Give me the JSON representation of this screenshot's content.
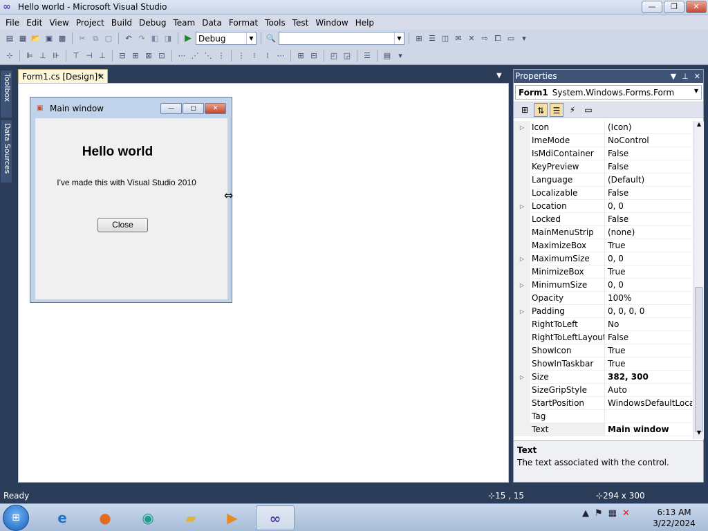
{
  "window": {
    "title": "Hello world - Microsoft Visual Studio",
    "buttons": {
      "minimize": "—",
      "restore": "❐",
      "close": "✕"
    }
  },
  "menu": [
    "File",
    "Edit",
    "View",
    "Project",
    "Build",
    "Debug",
    "Team",
    "Data",
    "Format",
    "Tools",
    "Test",
    "Window",
    "Help"
  ],
  "toolbar": {
    "config_value": "Debug",
    "platform_value": ""
  },
  "sidetabs": [
    "Toolbox",
    "Data Sources"
  ],
  "document_tab": {
    "label": "Form1.cs [Design]*",
    "close": "✕"
  },
  "form": {
    "title": "Main window",
    "heading": "Hello world",
    "subtitle": "I've made this with Visual Studio 2010",
    "close_button": "Close"
  },
  "properties": {
    "panel_title": "Properties",
    "object_name": "Form1",
    "object_type": "System.Windows.Forms.Form",
    "rows": [
      {
        "name": "Icon",
        "value": "(Icon)",
        "expand": true
      },
      {
        "name": "ImeMode",
        "value": "NoControl"
      },
      {
        "name": "IsMdiContainer",
        "value": "False"
      },
      {
        "name": "KeyPreview",
        "value": "False"
      },
      {
        "name": "Language",
        "value": "(Default)"
      },
      {
        "name": "Localizable",
        "value": "False"
      },
      {
        "name": "Location",
        "value": "0, 0",
        "expand": true
      },
      {
        "name": "Locked",
        "value": "False"
      },
      {
        "name": "MainMenuStrip",
        "value": "(none)"
      },
      {
        "name": "MaximizeBox",
        "value": "True"
      },
      {
        "name": "MaximumSize",
        "value": "0, 0",
        "expand": true
      },
      {
        "name": "MinimizeBox",
        "value": "True"
      },
      {
        "name": "MinimumSize",
        "value": "0, 0",
        "expand": true
      },
      {
        "name": "Opacity",
        "value": "100%"
      },
      {
        "name": "Padding",
        "value": "0, 0, 0, 0",
        "expand": true
      },
      {
        "name": "RightToLeft",
        "value": "No"
      },
      {
        "name": "RightToLeftLayout",
        "value": "False"
      },
      {
        "name": "ShowIcon",
        "value": "True"
      },
      {
        "name": "ShowInTaskbar",
        "value": "True"
      },
      {
        "name": "Size",
        "value": "382, 300",
        "expand": true,
        "bold": true
      },
      {
        "name": "SizeGripStyle",
        "value": "Auto"
      },
      {
        "name": "StartPosition",
        "value": "WindowsDefaultLocation"
      },
      {
        "name": "Tag",
        "value": ""
      },
      {
        "name": "Text",
        "value": "Main window",
        "bold": true,
        "selected": true
      }
    ],
    "description_title": "Text",
    "description_text": "The text associated with the control."
  },
  "status": {
    "text": "Ready",
    "position": "15 , 15",
    "size": "294 x 300"
  },
  "taskbar": {
    "time": "6:13 AM",
    "date": "3/22/2024"
  }
}
